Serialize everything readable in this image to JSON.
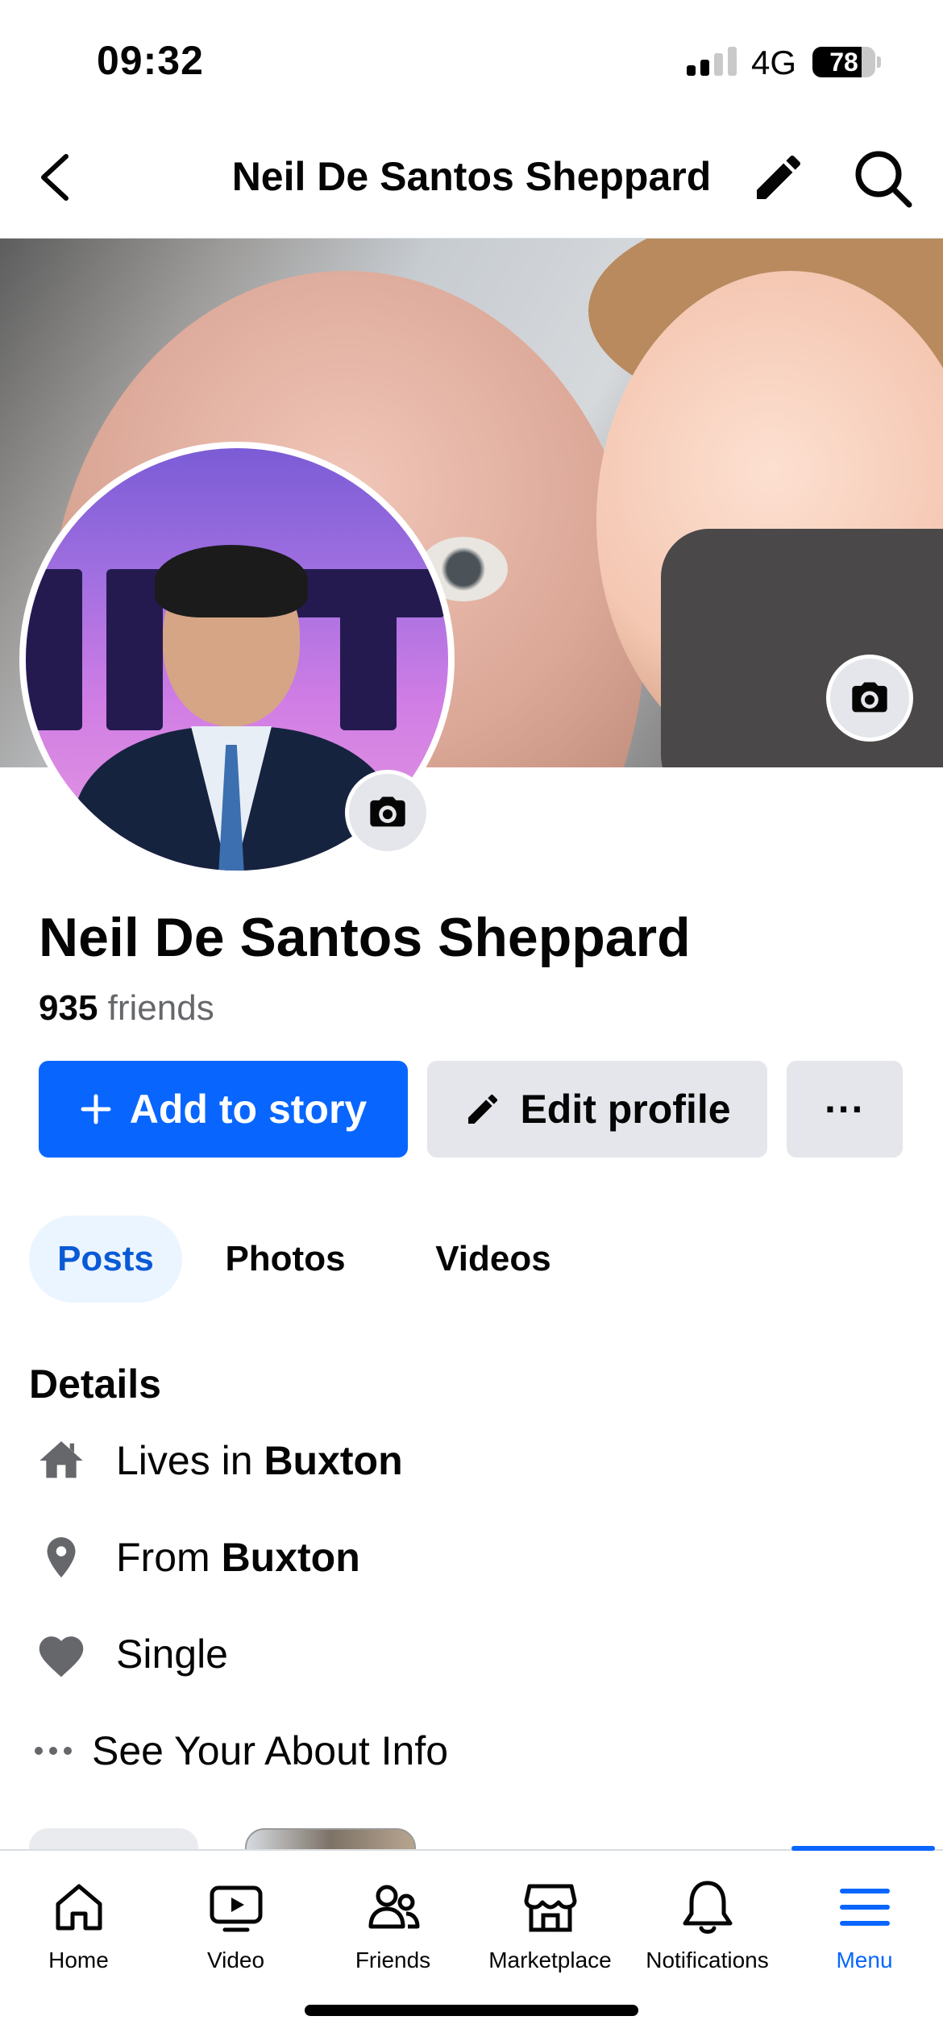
{
  "status_bar": {
    "time": "09:32",
    "network": "4G",
    "battery_level": 78,
    "battery_text": "78"
  },
  "header": {
    "title": "Neil De Santos Sheppard",
    "icons": [
      "back-chevron-icon",
      "pencil-icon",
      "search-icon"
    ]
  },
  "profile": {
    "name": "Neil De Santos Sheppard",
    "friends_count": "935",
    "friends_word": "friends"
  },
  "actions": {
    "add_story": "Add to story",
    "edit_profile": "Edit profile",
    "more": "···"
  },
  "tabs": [
    {
      "label": "Posts",
      "active": true
    },
    {
      "label": "Photos",
      "active": false
    },
    {
      "label": "Videos",
      "active": false
    }
  ],
  "details": {
    "title": "Details",
    "items": [
      {
        "icon": "home-icon",
        "prefix": "Lives in",
        "value": "Buxton"
      },
      {
        "icon": "location-pin-icon",
        "prefix": "From",
        "value": "Buxton"
      },
      {
        "icon": "heart-icon",
        "prefix": "Single",
        "value": ""
      }
    ],
    "about_link": "See Your About Info"
  },
  "bottom_nav": [
    {
      "label": "Home",
      "icon": "home-outline-icon",
      "active": false
    },
    {
      "label": "Video",
      "icon": "video-play-icon",
      "active": false
    },
    {
      "label": "Friends",
      "icon": "friends-icon",
      "active": false
    },
    {
      "label": "Marketplace",
      "icon": "marketplace-icon",
      "active": false
    },
    {
      "label": "Notifications",
      "icon": "bell-icon",
      "active": false
    },
    {
      "label": "Menu",
      "icon": "hamburger-menu-icon",
      "active": true
    }
  ],
  "colors": {
    "accent": "#0866ff",
    "button_gray": "#e4e6eb",
    "tab_active_bg": "#ebf5ff",
    "secondary_text": "#65676b",
    "icon_gray": "#65676b"
  }
}
